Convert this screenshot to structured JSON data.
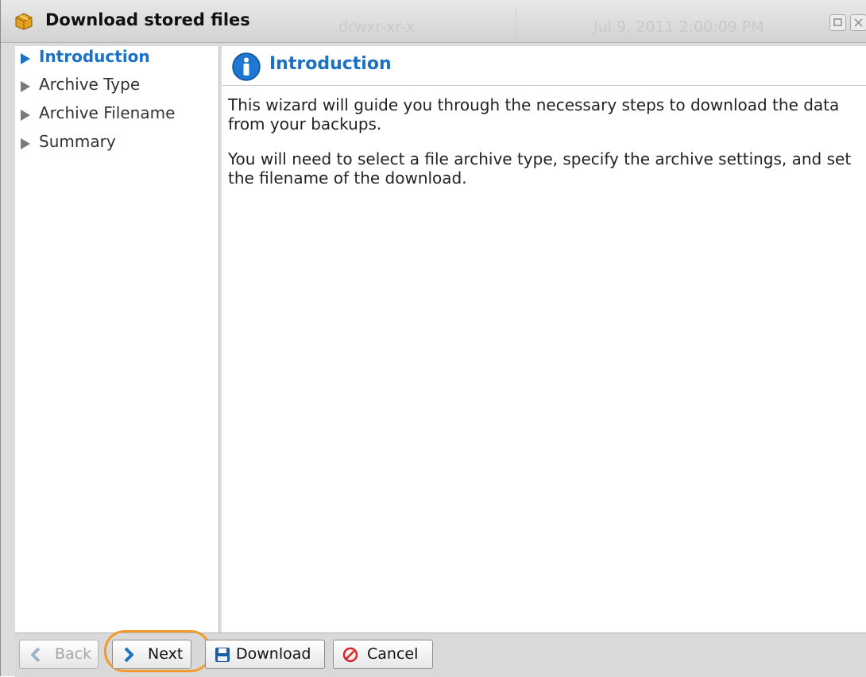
{
  "window": {
    "title": "Download stored files",
    "background_permissions": "drwxr-xr-x",
    "background_date": "Jul 9, 2011 2:00:09 PM"
  },
  "sidebar": {
    "steps": [
      {
        "label": "Introduction",
        "active": true
      },
      {
        "label": "Archive Type",
        "active": false
      },
      {
        "label": "Archive Filename",
        "active": false
      },
      {
        "label": "Summary",
        "active": false
      }
    ]
  },
  "main": {
    "title": "Introduction",
    "paragraph1": "This wizard will guide you through the necessary steps to download the data from your backups.",
    "paragraph2": "You will need to select a file archive type, specify the archive settings, and set the filename of the download."
  },
  "footer": {
    "back_label": "Back",
    "next_label": "Next",
    "download_label": "Download",
    "cancel_label": "Cancel"
  },
  "colors": {
    "accent": "#1b71c6",
    "highlight": "#f39a2c",
    "cancel_red": "#d9262b"
  }
}
